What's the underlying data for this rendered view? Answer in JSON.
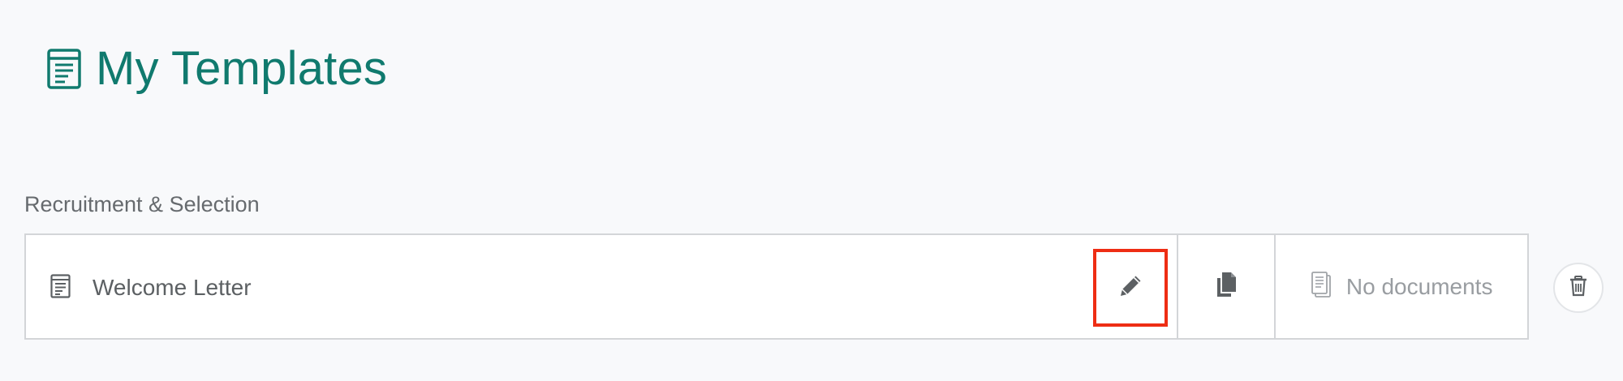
{
  "header": {
    "title": "My Templates",
    "icon": "document-list-icon",
    "accent_color": "#107a6e"
  },
  "section": {
    "label": "Recruitment & Selection"
  },
  "template": {
    "name": "Welcome Letter",
    "icon": "document-list-icon",
    "actions": {
      "edit_icon": "pencil-icon",
      "copy_icon": "copy-icon",
      "documents_icon": "documents-icon",
      "documents_label": "No documents",
      "delete_icon": "trash-icon"
    }
  },
  "highlight_color": "#ee2d14"
}
